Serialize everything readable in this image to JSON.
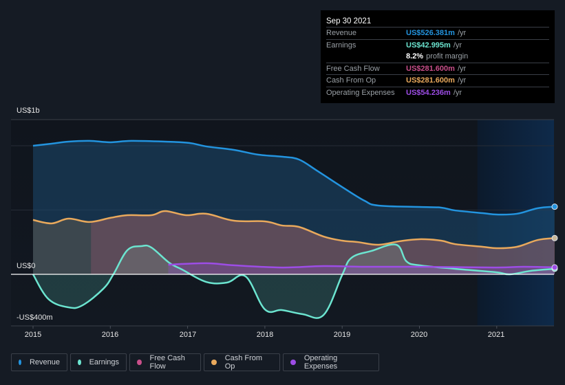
{
  "tooltip": {
    "date": "Sep 30 2021",
    "rows": [
      {
        "label": "Revenue",
        "value": "US$526.381m",
        "unit": "/yr",
        "color": "#2394df"
      },
      {
        "label": "Earnings",
        "value": "US$42.995m",
        "unit": "/yr",
        "color": "#6ce5d0"
      },
      {
        "label": "",
        "value": "8.2%",
        "unit": "profit margin",
        "color": "#ffffff"
      },
      {
        "label": "Free Cash Flow",
        "value": "US$281.600m",
        "unit": "/yr",
        "color": "#c94f8a"
      },
      {
        "label": "Cash From Op",
        "value": "US$281.600m",
        "unit": "/yr",
        "color": "#e9a95c"
      },
      {
        "label": "Operating Expenses",
        "value": "US$54.236m",
        "unit": "/yr",
        "color": "#9d4de6"
      }
    ]
  },
  "legend": [
    {
      "label": "Revenue",
      "color": "#2394df"
    },
    {
      "label": "Earnings",
      "color": "#6ce5d0"
    },
    {
      "label": "Free Cash Flow",
      "color": "#c94f8a"
    },
    {
      "label": "Cash From Op",
      "color": "#e9a95c"
    },
    {
      "label": "Operating Expenses",
      "color": "#9d4de6"
    }
  ],
  "chart_data": {
    "type": "area",
    "title": "",
    "xlabel": "",
    "ylabel": "",
    "y_tick_labels": [
      "US$1b",
      "US$0",
      "-US$400m"
    ],
    "x_tick_labels": [
      "2015",
      "2016",
      "2017",
      "2018",
      "2019",
      "2020",
      "2021"
    ],
    "xlim": [
      2014.7,
      2021.75
    ],
    "ylim": [
      -400,
      1200
    ],
    "units": "US$m",
    "grid": true,
    "legend_position": "bottom",
    "highlight_range": [
      2020.75,
      2021.75
    ],
    "series": [
      {
        "name": "Revenue",
        "color": "#2394df",
        "x": [
          2015.0,
          2015.24,
          2015.46,
          2015.73,
          2016.0,
          2016.27,
          2016.71,
          2017.02,
          2017.24,
          2017.6,
          2017.91,
          2018.22,
          2018.44,
          2018.67,
          2019.0,
          2019.29,
          2019.47,
          2020.0,
          2020.28,
          2020.46,
          2020.82,
          2021.0,
          2021.26,
          2021.53,
          2021.75
        ],
        "values": [
          1000,
          1016,
          1032,
          1038,
          1027,
          1038,
          1032,
          1022,
          995,
          968,
          931,
          915,
          893,
          808,
          679,
          572,
          535,
          524,
          519,
          497,
          476,
          465,
          471,
          514,
          526
        ]
      },
      {
        "name": "Earnings",
        "color": "#6ce5d0",
        "x": [
          2015.0,
          2015.2,
          2015.46,
          2015.64,
          2015.91,
          2016.04,
          2016.22,
          2016.4,
          2016.53,
          2016.76,
          2016.93,
          2017.24,
          2017.51,
          2017.75,
          2018.0,
          2018.22,
          2018.49,
          2018.76,
          2019.0,
          2019.12,
          2019.38,
          2019.7,
          2019.83,
          2020.0,
          2020.46,
          2020.99,
          2021.17,
          2021.44,
          2021.75
        ],
        "values": [
          0,
          -193,
          -257,
          -241,
          -112,
          0,
          187,
          219,
          209,
          91,
          37,
          -59,
          -64,
          -16,
          -273,
          -278,
          -310,
          -316,
          -5,
          128,
          182,
          230,
          102,
          70,
          43,
          16,
          0,
          27,
          43
        ]
      },
      {
        "name": "Free Cash Flow",
        "color": "#c94f8a",
        "x": [
          2015.75,
          2016.0,
          2016.22,
          2016.53,
          2016.71,
          2016.98,
          2017.24,
          2017.6,
          2018.0,
          2018.22,
          2018.44,
          2018.76,
          2019.0,
          2019.2,
          2019.47,
          2019.74,
          2020.0,
          2020.28,
          2020.46,
          2020.82,
          2021.0,
          2021.26,
          2021.53,
          2021.75
        ],
        "values": [
          407,
          439,
          460,
          460,
          492,
          460,
          471,
          417,
          412,
          380,
          369,
          294,
          262,
          251,
          230,
          257,
          273,
          262,
          235,
          214,
          203,
          214,
          267,
          282
        ]
      },
      {
        "name": "Cash From Op",
        "color": "#e9a95c",
        "x": [
          2015.0,
          2015.24,
          2015.46,
          2015.73,
          2016.0,
          2016.22,
          2016.53,
          2016.71,
          2016.98,
          2017.24,
          2017.6,
          2018.0,
          2018.22,
          2018.44,
          2018.76,
          2019.0,
          2019.2,
          2019.47,
          2019.74,
          2020.0,
          2020.28,
          2020.46,
          2020.82,
          2021.0,
          2021.26,
          2021.53,
          2021.75
        ],
        "values": [
          423,
          396,
          433,
          407,
          439,
          460,
          460,
          492,
          460,
          471,
          417,
          412,
          380,
          369,
          294,
          262,
          251,
          230,
          257,
          273,
          262,
          235,
          214,
          203,
          214,
          267,
          282
        ]
      },
      {
        "name": "Operating Expenses",
        "color": "#9d4de6",
        "x": [
          2016.75,
          2017.24,
          2017.6,
          2018.22,
          2018.76,
          2019.29,
          2020.0,
          2020.99,
          2021.35,
          2021.75
        ],
        "values": [
          75,
          86,
          70,
          53,
          64,
          59,
          59,
          53,
          59,
          54
        ]
      }
    ]
  }
}
